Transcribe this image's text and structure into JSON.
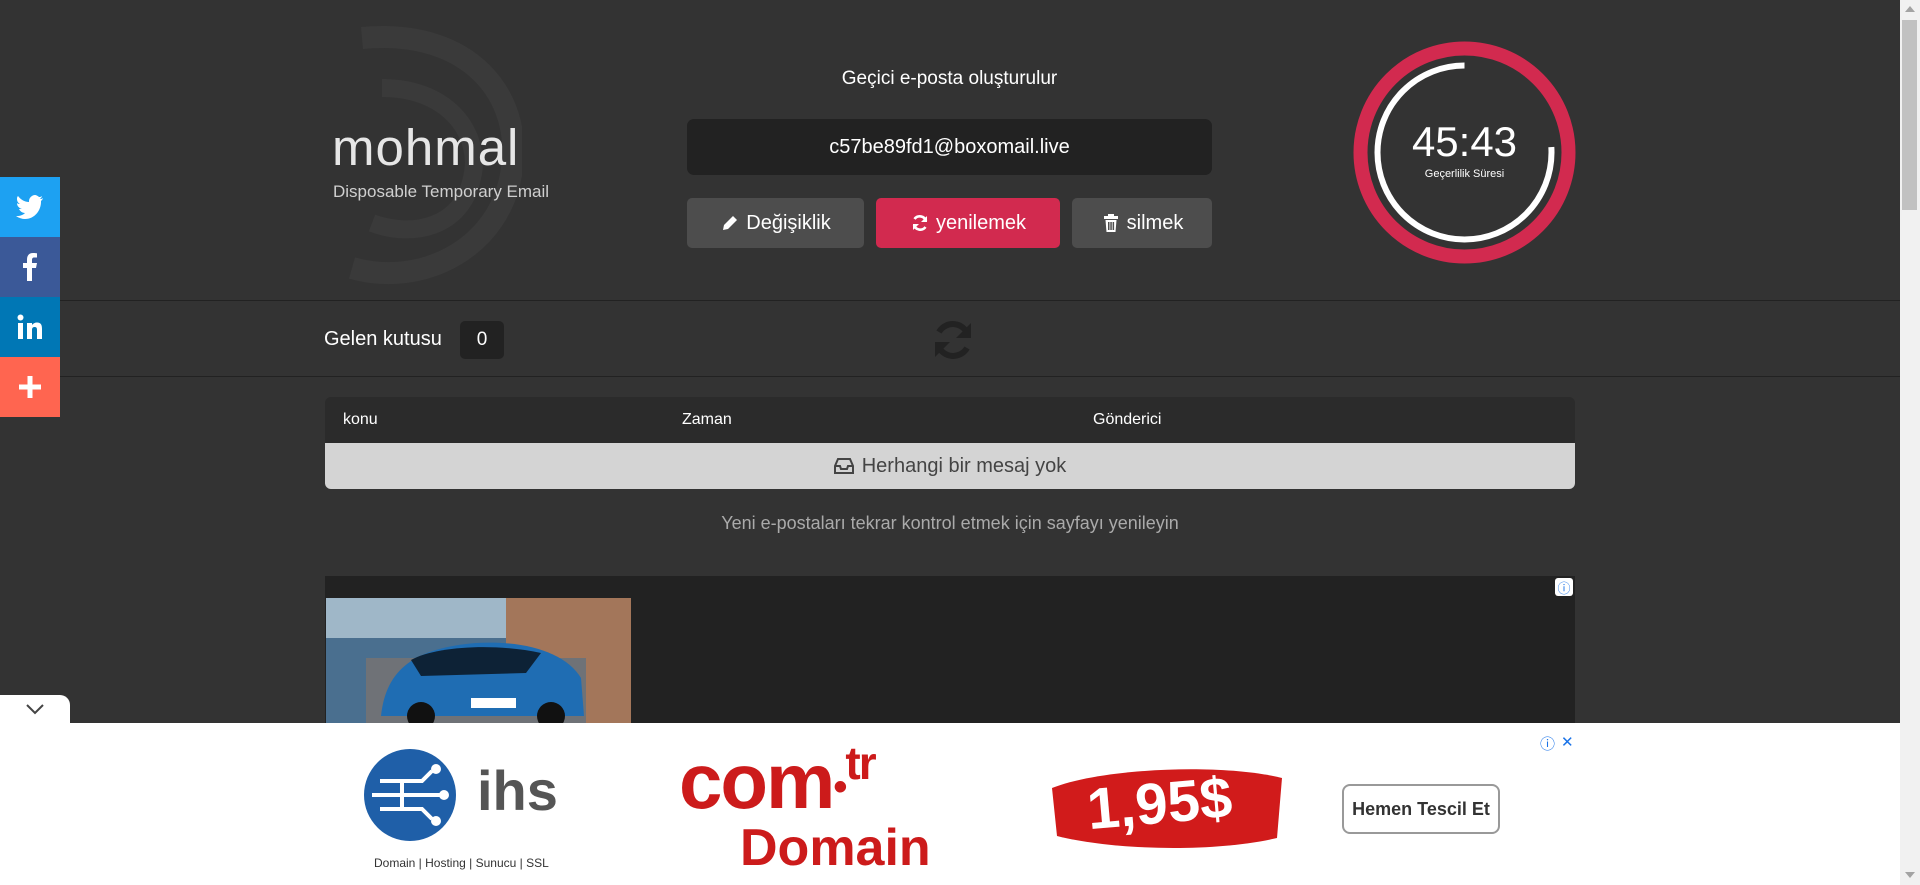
{
  "header": {
    "logo_text": "mohmal",
    "logo_subtitle": "Disposable Temporary Email",
    "generated_label": "Geçici e-posta oluşturulur",
    "email": "c57be89fd1@boxomail.live",
    "buttons": {
      "change": "Değişiklik",
      "refresh": "yenilemek",
      "delete": "silmek"
    },
    "timer": {
      "value": "45:43",
      "label": "Geçerlilik Süresi",
      "remaining_fraction": 0.76
    }
  },
  "inbox": {
    "label": "Gelen kutusu",
    "count": "0"
  },
  "table": {
    "columns": [
      "konu",
      "Zaman",
      "Gönderici"
    ],
    "empty_message": "Herhangi bir mesaj yok",
    "hint": "Yeni e-postaları tekrar kontrol etmek için sayfayı yenileyin"
  },
  "social": [
    "twitter-icon",
    "facebook-icon",
    "linkedin-icon",
    "plus-icon"
  ],
  "banner": {
    "brand": "ihs",
    "brand_tagline": "Domain | Hosting | Sunucu | SSL",
    "product_top": "com",
    "product_tld": "tr",
    "product_bottom": "Domain",
    "price": "1,95$",
    "cta": "Hemen Tescil Et"
  },
  "colors": {
    "accent": "#d22a4f",
    "background": "#333333",
    "twitter": "#1da1f2",
    "facebook": "#3b5998",
    "linkedin": "#0077b5",
    "more": "#ff6550"
  }
}
